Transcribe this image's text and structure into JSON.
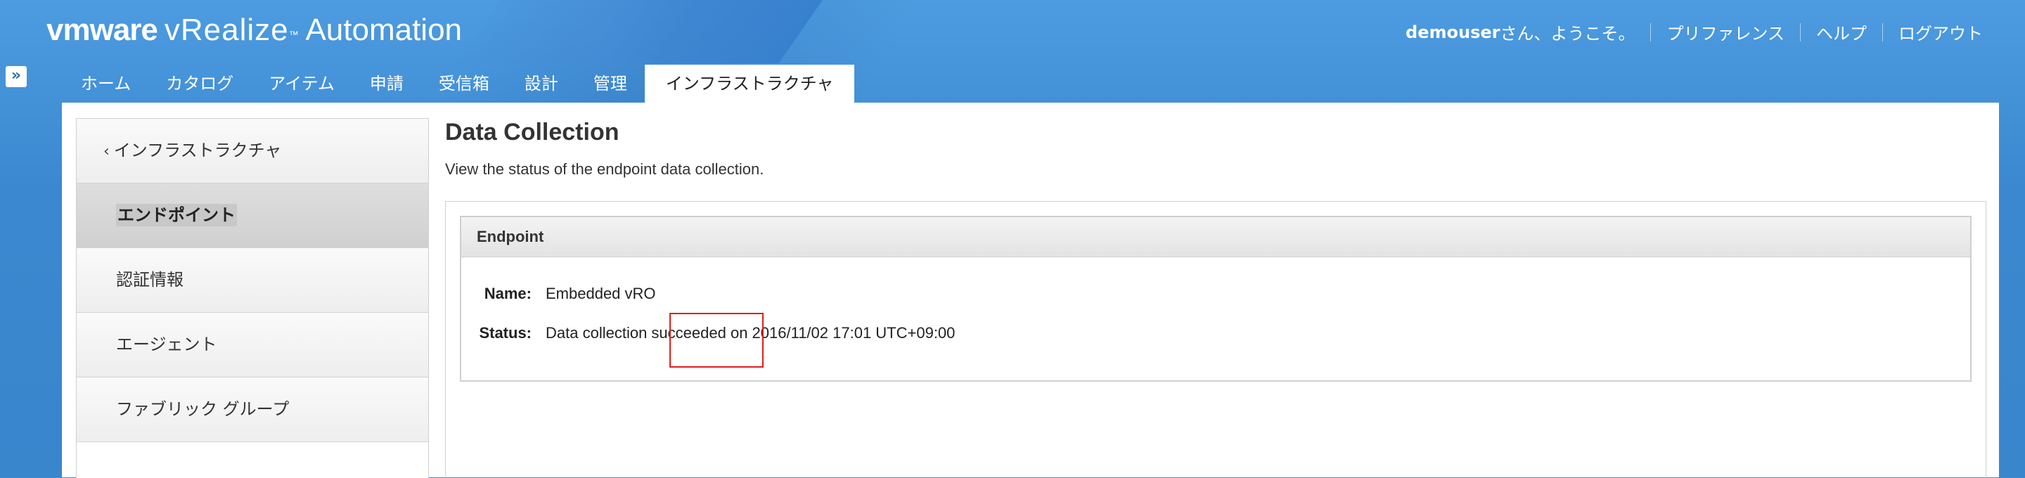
{
  "app": {
    "brand_vm": "vmware",
    "product": "vRealize",
    "product_tm": "™",
    "product_suffix": "Automation"
  },
  "user_links": {
    "user": "demouser",
    "greeting": " さん、ようこそ。",
    "preferences": "プリファレンス",
    "help": "ヘルプ",
    "logout": "ログアウト"
  },
  "expander_icon": "»",
  "tabs": [
    {
      "label": "ホーム"
    },
    {
      "label": "カタログ"
    },
    {
      "label": "アイテム"
    },
    {
      "label": "申請"
    },
    {
      "label": "受信箱"
    },
    {
      "label": "設計"
    },
    {
      "label": "管理"
    },
    {
      "label": "インフラストラクチャ"
    }
  ],
  "sidebar": {
    "back_label": "インフラストラクチャ",
    "items": [
      {
        "label": "エンドポイント"
      },
      {
        "label": "認証情報"
      },
      {
        "label": "エージェント"
      },
      {
        "label": "ファブリック グループ"
      }
    ]
  },
  "page": {
    "title": "Data Collection",
    "subtitle": "View the status of the endpoint data collection."
  },
  "panel": {
    "header": "Endpoint",
    "name_label": "Name:",
    "name_value": "Embedded vRO",
    "status_label": "Status:",
    "status_prefix": "Data collection ",
    "status_state": "succeeded",
    "status_suffix": " on 2016/11/02 17:01 UTC+09:00"
  },
  "colors": {
    "header_blue": "#3a86cd",
    "highlight_red": "#e01e1e"
  }
}
